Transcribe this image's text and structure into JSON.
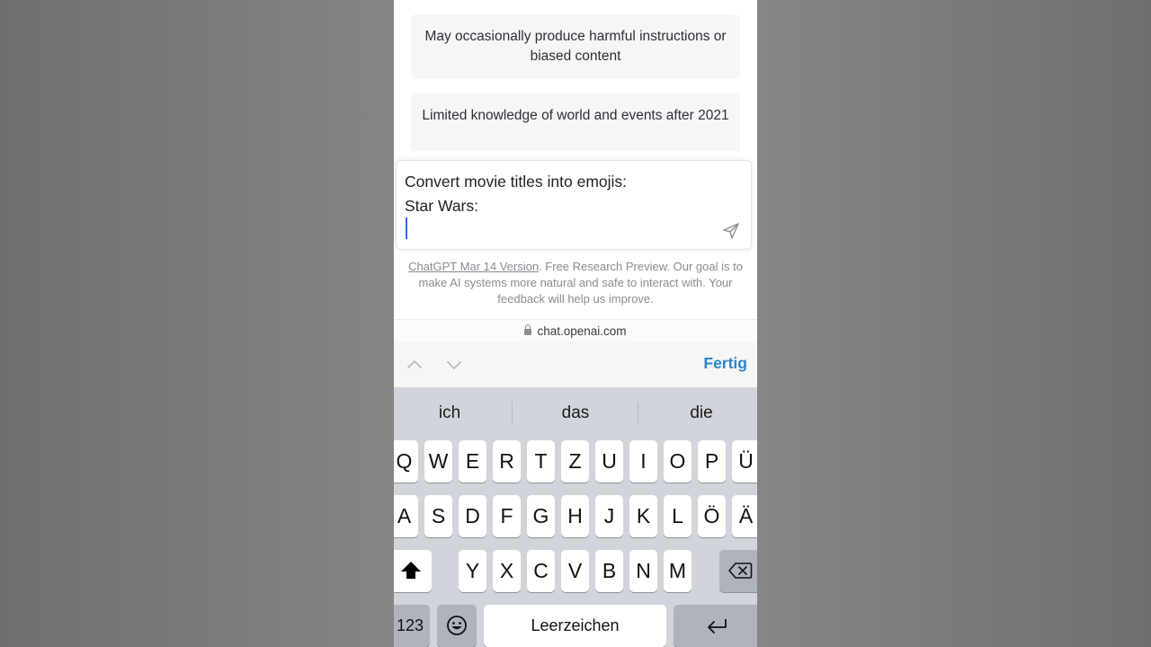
{
  "limitations": {
    "card_top": "",
    "card_1": "May occasionally produce harmful instructions or biased content",
    "card_2": "Limited knowledge of world and events after 2021"
  },
  "composer": {
    "line_1": "Convert movie titles into emojis:",
    "line_2": "Star Wars:",
    "send_icon": "paper-plane-icon"
  },
  "disclaimer": {
    "link_text": "ChatGPT Mar 14 Version",
    "text": ". Free Research Preview. Our goal is to make AI systems more natural and safe to interact with. Your feedback will help us improve."
  },
  "browser": {
    "url": "chat.openai.com",
    "lock_icon": "lock-icon"
  },
  "form_toolbar": {
    "done_label": "Fertig",
    "prev_icon": "chevron-up-icon",
    "next_icon": "chevron-down-icon"
  },
  "keyboard": {
    "suggestions": [
      "ich",
      "das",
      "die"
    ],
    "row1": [
      "Q",
      "W",
      "E",
      "R",
      "T",
      "Z",
      "U",
      "I",
      "O",
      "P",
      "Ü"
    ],
    "row2": [
      "A",
      "S",
      "D",
      "F",
      "G",
      "H",
      "J",
      "K",
      "L",
      "Ö",
      "Ä"
    ],
    "row3": [
      "Y",
      "X",
      "C",
      "V",
      "B",
      "N",
      "M"
    ],
    "numbers_label": "123",
    "space_label": "Leerzeichen",
    "shift_icon": "shift-icon",
    "backspace_icon": "backspace-icon",
    "emoji_icon": "emoji-icon",
    "return_icon": "return-icon"
  },
  "colors": {
    "accent": "#2b86c9",
    "keyboard_bg": "#d1d4da"
  }
}
